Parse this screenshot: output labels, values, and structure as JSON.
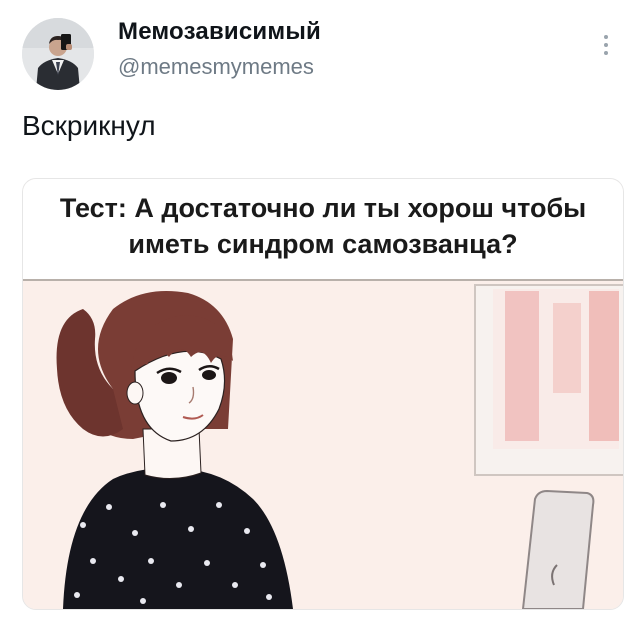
{
  "tweet": {
    "author_name": "Мемозависимый",
    "author_handle": "@memesmymemes",
    "text": "Вскрикнул",
    "more_icon": "more-vertical-icon"
  },
  "meme": {
    "caption_line1": "Тест: А достаточно ли ты хорош чтобы",
    "caption_line2": "иметь синдром самозванца?"
  }
}
